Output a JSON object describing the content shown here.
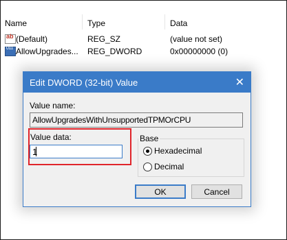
{
  "list": {
    "columns": [
      "Name",
      "Type",
      "Data"
    ],
    "rows": [
      {
        "icon": "string-value-icon",
        "icon_text": "ab",
        "name": "(Default)",
        "type": "REG_SZ",
        "data": "(value not set)"
      },
      {
        "icon": "dword-value-icon",
        "icon_text": "011",
        "name": "AllowUpgrades...",
        "type": "REG_DWORD",
        "data": "0x00000000 (0)"
      }
    ]
  },
  "dialog": {
    "title": "Edit DWORD (32-bit) Value",
    "close_glyph": "✕",
    "value_name_label": "Value name:",
    "value_name": "AllowUpgradesWithUnsupportedTPMOrCPU",
    "value_data_label": "Value data:",
    "value_data": "1",
    "base_label": "Base",
    "base_options": [
      {
        "label": "Hexadecimal",
        "selected": true
      },
      {
        "label": "Decimal",
        "selected": false
      }
    ],
    "ok_label": "OK",
    "cancel_label": "Cancel"
  },
  "colors": {
    "accent": "#3a7bc8",
    "highlight_border": "#e0242a"
  }
}
